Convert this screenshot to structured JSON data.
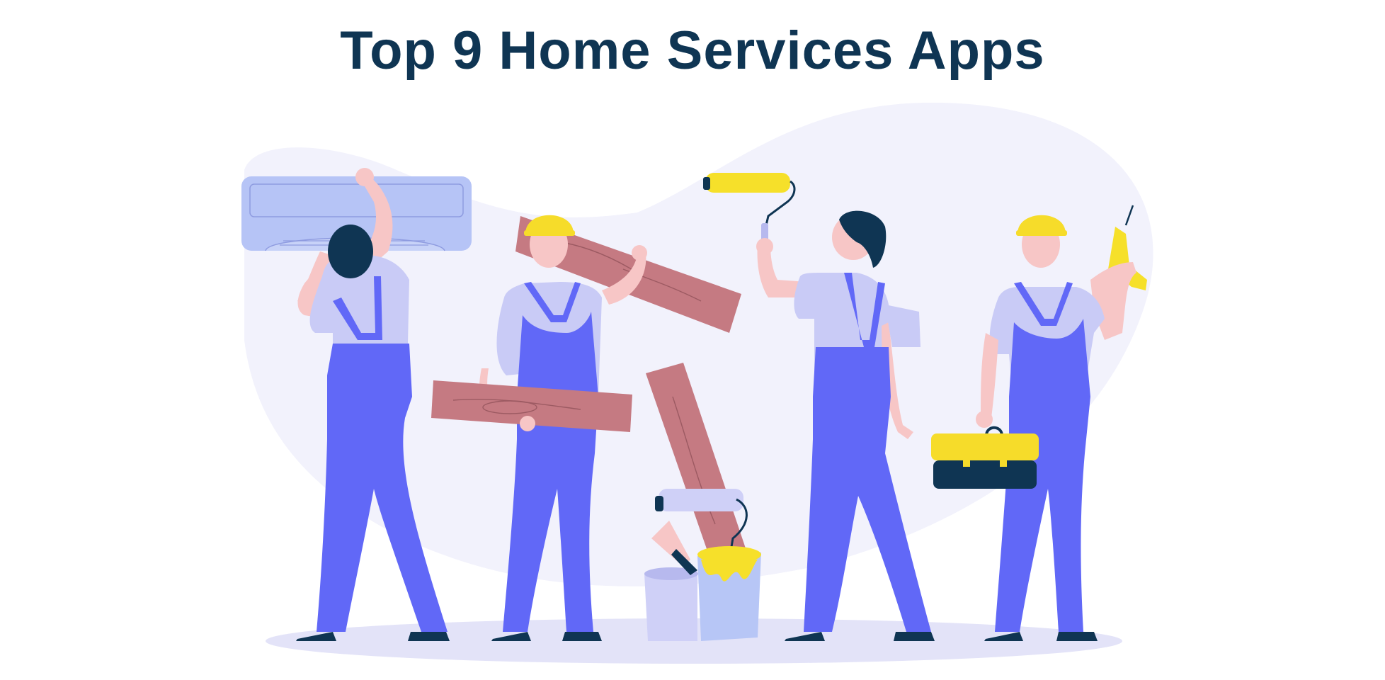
{
  "title": "Top 9 Home Services Apps",
  "colors": {
    "title": "#0f3553",
    "blob": "#f2f2fc",
    "floor_shadow": "#e3e3f8",
    "overalls": "#6168f7",
    "shirt": "#c9cbf6",
    "skin": "#f7c6c6",
    "hair": "#0f3553",
    "helmet": "#f6dc2a",
    "wood": "#c57a82",
    "wood_grain": "#9c5a62",
    "ac_unit": "#b6c4f6",
    "toolbox_base": "#0f3553",
    "paint_yellow": "#f6e02a",
    "bucket_left": "#cfd0f7",
    "bucket_right": "#b7c6f6"
  },
  "figures": [
    {
      "role": "ac-installer",
      "facing": "back",
      "hair": "dark",
      "holding": "air-conditioner-unit"
    },
    {
      "role": "carpenter",
      "helmet": "yellow",
      "holding": "wooden-planks"
    },
    {
      "role": "painter",
      "hair": "dark",
      "holding": "yellow-paint-roller"
    },
    {
      "role": "electrician",
      "helmet": "yellow",
      "holding": [
        "toolbox",
        "power-drill"
      ]
    }
  ],
  "props": [
    "paint-bucket-yellow",
    "paint-bucket-blue",
    "paint-brush",
    "paint-roller-lavender",
    "leaning-plank"
  ]
}
